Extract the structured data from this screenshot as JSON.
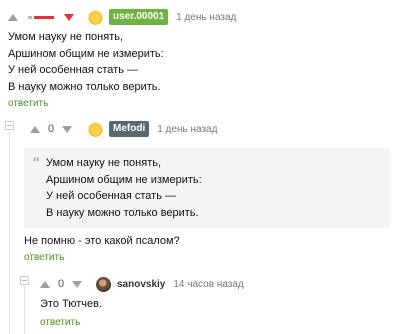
{
  "comments": [
    {
      "score_display": "",
      "username": "user.00001",
      "username_color": "#6db33f",
      "time": "1 день назад",
      "lines": [
        "Умом науку не понять,",
        "Аршином общим не измерить:",
        "У ней особенная стать —",
        "В науку можно только верить."
      ],
      "reply_label": "ответить"
    },
    {
      "score": "0",
      "username": "Mefodi",
      "username_color": "#5a6670",
      "time": "1 день назад",
      "quote_lines": [
        "Умом науку не понять,",
        "Аршином общим не измерить:",
        "У ней особенная стать —",
        "В науку можно только верить."
      ],
      "text": "Не помню - это какой псалом?",
      "reply_label": "ответить"
    },
    {
      "score": "0",
      "username": "sanovskiy",
      "time": "14 часов назад",
      "text": "Это Тютчев.",
      "reply_label": "ответить"
    }
  ],
  "icons": {
    "upvote": "arrow-up-icon",
    "downvote": "arrow-down-icon",
    "collapse": "collapse-icon",
    "quote": "quote-icon"
  },
  "colors": {
    "reply_link": "#4a8d1f",
    "downvote_active": "#e0333a",
    "quote_bg": "#f4f4f4"
  }
}
